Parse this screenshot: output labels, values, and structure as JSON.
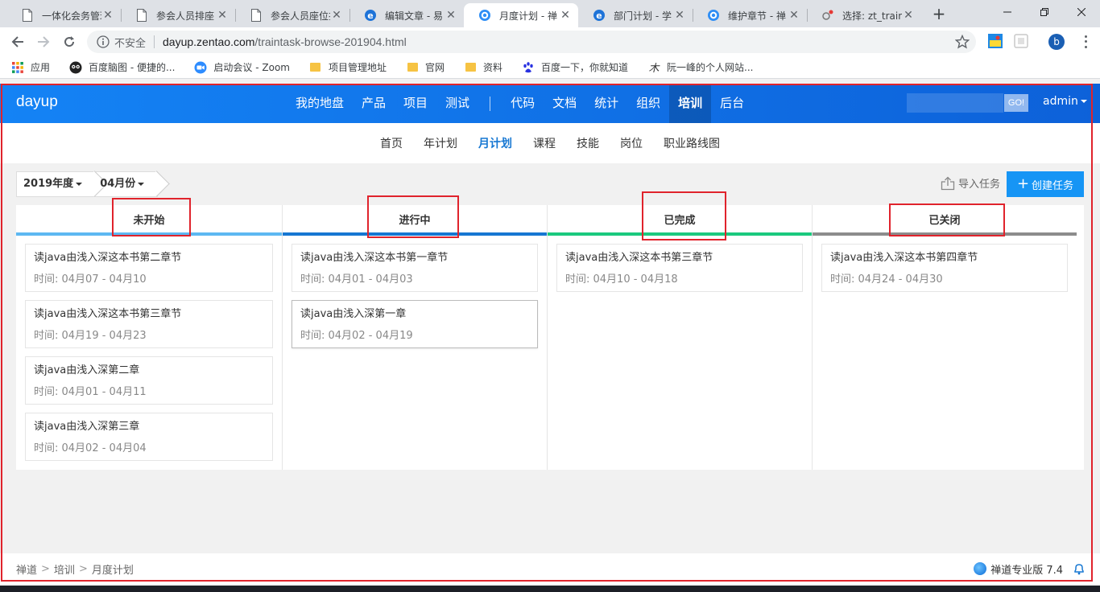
{
  "browser": {
    "tabs": [
      {
        "title": "一体化会务管理",
        "icon": "page-icon",
        "active": false
      },
      {
        "title": "参会人员排座",
        "icon": "page-icon",
        "active": false
      },
      {
        "title": "参会人员座位排",
        "icon": "page-icon",
        "active": false
      },
      {
        "title": "编辑文章 - 易",
        "icon": "ie-icon",
        "active": false
      },
      {
        "title": "月度计划 - 禅",
        "icon": "zentao-icon",
        "active": true
      },
      {
        "title": "部门计划 - 学",
        "icon": "ie-icon",
        "active": false
      },
      {
        "title": "维护章节 - 禅",
        "icon": "zentao-icon",
        "active": false
      },
      {
        "title": "选择: zt_train",
        "icon": "db-icon",
        "active": false
      }
    ],
    "new_tab": "+",
    "not_secure": "不安全",
    "url_host": "dayup.zentao.com",
    "url_path": "/traintask-browse-201904.html",
    "profile_initial": "b",
    "bookmarks": [
      {
        "label": "应用",
        "icon": "apps-grid-icon"
      },
      {
        "label": "百度脑图 - 便捷的...",
        "icon": "owl-icon"
      },
      {
        "label": "启动会议 - Zoom",
        "icon": "zoom-icon"
      },
      {
        "label": "项目管理地址",
        "icon": "folder-icon"
      },
      {
        "label": "官网",
        "icon": "folder-icon"
      },
      {
        "label": "资料",
        "icon": "folder-icon"
      },
      {
        "label": "百度一下，你就知道",
        "icon": "baidu-paw-icon"
      },
      {
        "label": "阮一峰的个人网站...",
        "icon": "ruanyifeng-icon"
      }
    ]
  },
  "app": {
    "brand": "dayup",
    "nav_left": [
      "我的地盘",
      "产品",
      "项目",
      "测试"
    ],
    "nav_right": [
      "代码",
      "文档",
      "统计",
      "组织",
      "培训",
      "后台"
    ],
    "nav_active": "培训",
    "search_go": "GO!",
    "user": "admin",
    "subnav": [
      "首页",
      "年计划",
      "月计划",
      "课程",
      "技能",
      "岗位",
      "职业路线图"
    ],
    "subnav_active": "月计划",
    "filter_year": "2019年度",
    "filter_month": "04月份",
    "import_label": "导入任务",
    "create_label": "创建任务",
    "colors": {
      "not_started": "#5db8f2",
      "in_progress": "#1677d2",
      "done": "#1bc97e",
      "closed": "#8c8c8c",
      "annotation": "#e0232c"
    },
    "columns": [
      {
        "title": "未开始",
        "cards": [
          {
            "title": "读java由浅入深这本书第二章节",
            "time": "时间: 04月07 - 04月10"
          },
          {
            "title": "读java由浅入深这本书第三章节",
            "time": "时间: 04月19 - 04月23"
          },
          {
            "title": "读java由浅入深第二章",
            "time": "时间: 04月01 - 04月11"
          },
          {
            "title": "读java由浅入深第三章",
            "time": "时间: 04月02 - 04月04"
          }
        ]
      },
      {
        "title": "进行中",
        "cards": [
          {
            "title": "读java由浅入深这本书第一章节",
            "time": "时间: 04月01 - 04月03"
          },
          {
            "title": "读java由浅入深第一章",
            "time": "时间: 04月02 - 04月19"
          }
        ]
      },
      {
        "title": "已完成",
        "cards": [
          {
            "title": "读java由浅入深这本书第三章节",
            "time": "时间: 04月10 - 04月18"
          }
        ]
      },
      {
        "title": "已关闭",
        "cards": [
          {
            "title": "读java由浅入深这本书第四章节",
            "time": "时间: 04月24 - 04月30"
          }
        ]
      }
    ],
    "breadcrumb": [
      "禅道",
      "培训",
      "月度计划"
    ],
    "version": "禅道专业版 7.4"
  }
}
